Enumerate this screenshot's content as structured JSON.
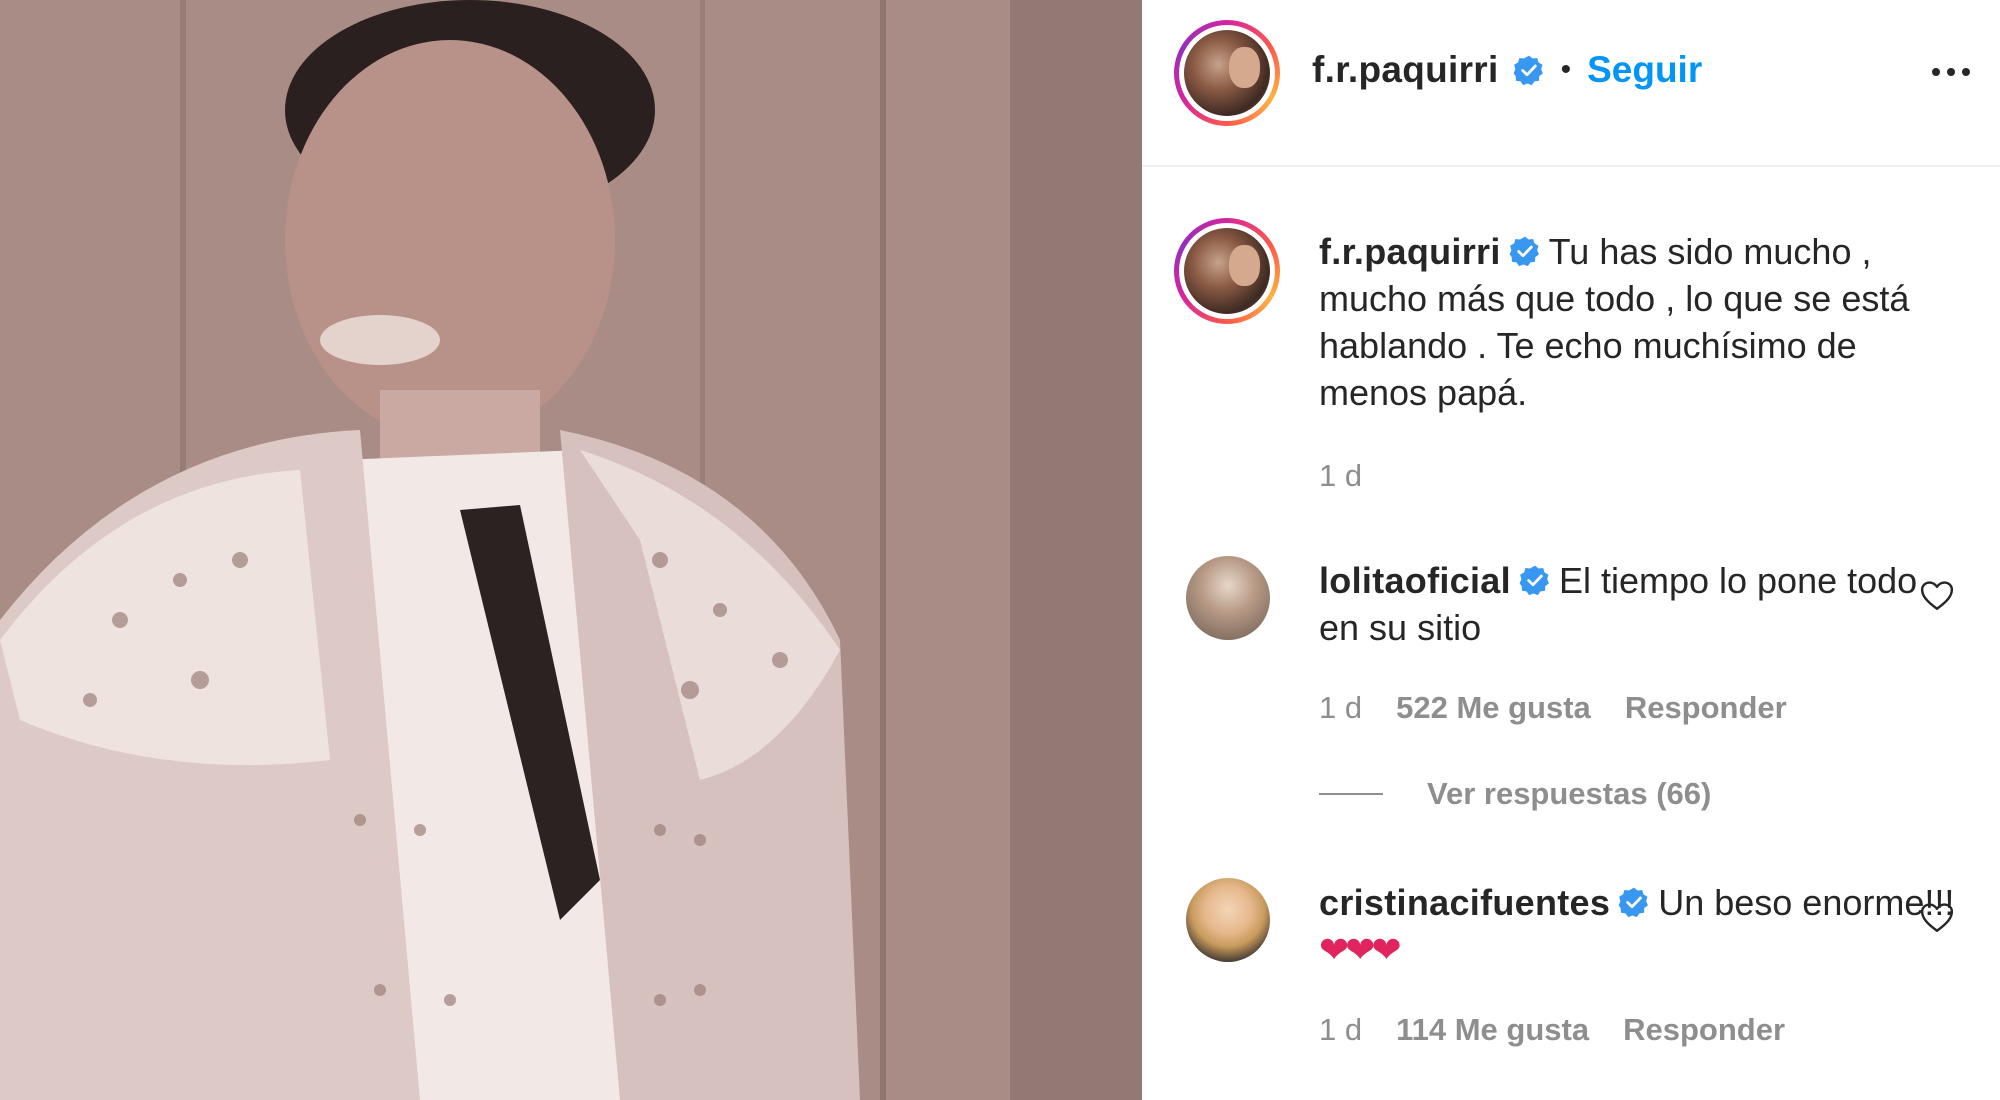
{
  "post": {
    "author": "f.r.paquirri",
    "follow_label": "Seguir",
    "separator": "•",
    "caption": "Tu has sido mucho , mucho más que todo , lo que se está hablando . Te echo muchísimo de menos papá.",
    "caption_time": "1 d"
  },
  "comments": [
    {
      "username": "lolitaoficial",
      "text": "El tiempo lo pone todo en su sitio",
      "time": "1 d",
      "likes": "522 Me gusta",
      "reply_label": "Responder",
      "view_replies": "Ver respuestas (66)"
    },
    {
      "username": "cristinacifuentes",
      "text": "Un beso enorme!!!",
      "emoji": "❤❤❤",
      "time": "1 d",
      "likes": "114 Me gusta",
      "reply_label": "Responder"
    }
  ],
  "icons": {
    "verified": "verified-badge-icon",
    "more": "more-options-icon",
    "like": "heart-outline-icon"
  },
  "colors": {
    "link_blue": "#0095f6",
    "verified_blue": "#3897f0",
    "meta_gray": "#8e8e8e",
    "text": "#262626"
  }
}
